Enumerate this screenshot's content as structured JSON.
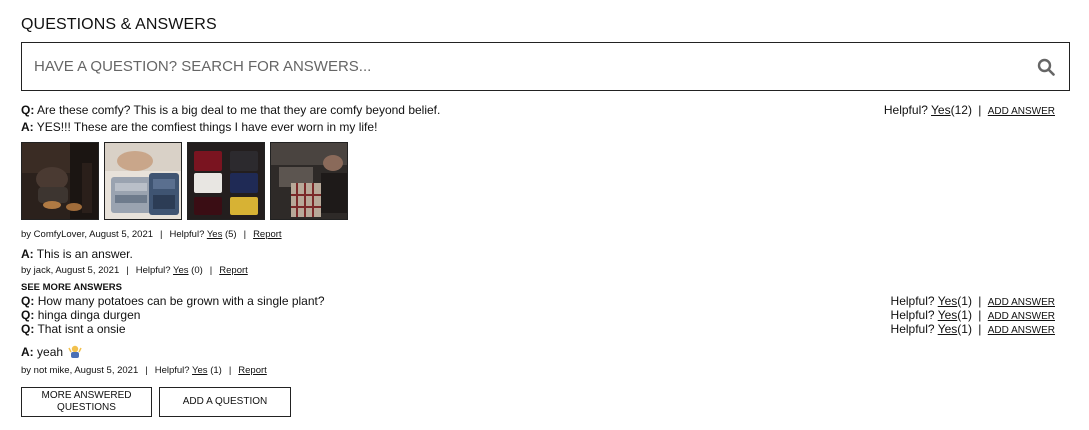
{
  "section": {
    "title": "QUESTIONS & ANSWERS"
  },
  "search": {
    "placeholder": "HAVE A QUESTION? SEARCH FOR ANSWERS..."
  },
  "qa": [
    {
      "question": "Are these comfy? This is a big deal to me that they are comfy beyond belief.",
      "helpful_label": "Helpful?",
      "yes_label": "Yes",
      "helpful_count": "(12)",
      "sep": "|",
      "add_answer": "ADD ANSWER",
      "answers": [
        {
          "text": "YES!!! These are the comfiest things I have ever worn in my life!",
          "byline": "by ComfyLover, August 5, 2021",
          "helpful_label": "Helpful?",
          "yes_label": "Yes",
          "count": "(5)",
          "report": "Report"
        },
        {
          "text": "This is an answer.",
          "byline": "by jack, August 5, 2021",
          "helpful_label": "Helpful?",
          "yes_label": "Yes",
          "count": "(0)",
          "report": "Report"
        }
      ]
    },
    {
      "question": "How many potatoes can be grown with a single plant?",
      "helpful_label": "Helpful?",
      "yes_label": "Yes",
      "helpful_count": "(1)",
      "sep": "|",
      "add_answer": "ADD ANSWER"
    },
    {
      "question": "hinga dinga durgen",
      "helpful_label": "Helpful?",
      "yes_label": "Yes",
      "helpful_count": "(1)",
      "sep": "|",
      "add_answer": "ADD ANSWER"
    },
    {
      "question": "That isnt a onsie",
      "helpful_label": "Helpful?",
      "yes_label": "Yes",
      "helpful_count": "(1)",
      "sep": "|",
      "add_answer": "ADD ANSWER",
      "answers": [
        {
          "text": "yeah",
          "byline": "by not mike, August 5, 2021",
          "helpful_label": "Helpful?",
          "yes_label": "Yes",
          "count": "(1)",
          "report": "Report"
        }
      ]
    }
  ],
  "labels": {
    "q": "Q:",
    "a": "A:",
    "meta_sep": "|"
  },
  "see_more": "SEE MORE ANSWERS",
  "buttons": {
    "more_answered": "MORE ANSWERED QUESTIONS",
    "add_question": "ADD A QUESTION"
  },
  "icons": {
    "search": "search-icon",
    "emoji": "person-emoji-icon"
  }
}
